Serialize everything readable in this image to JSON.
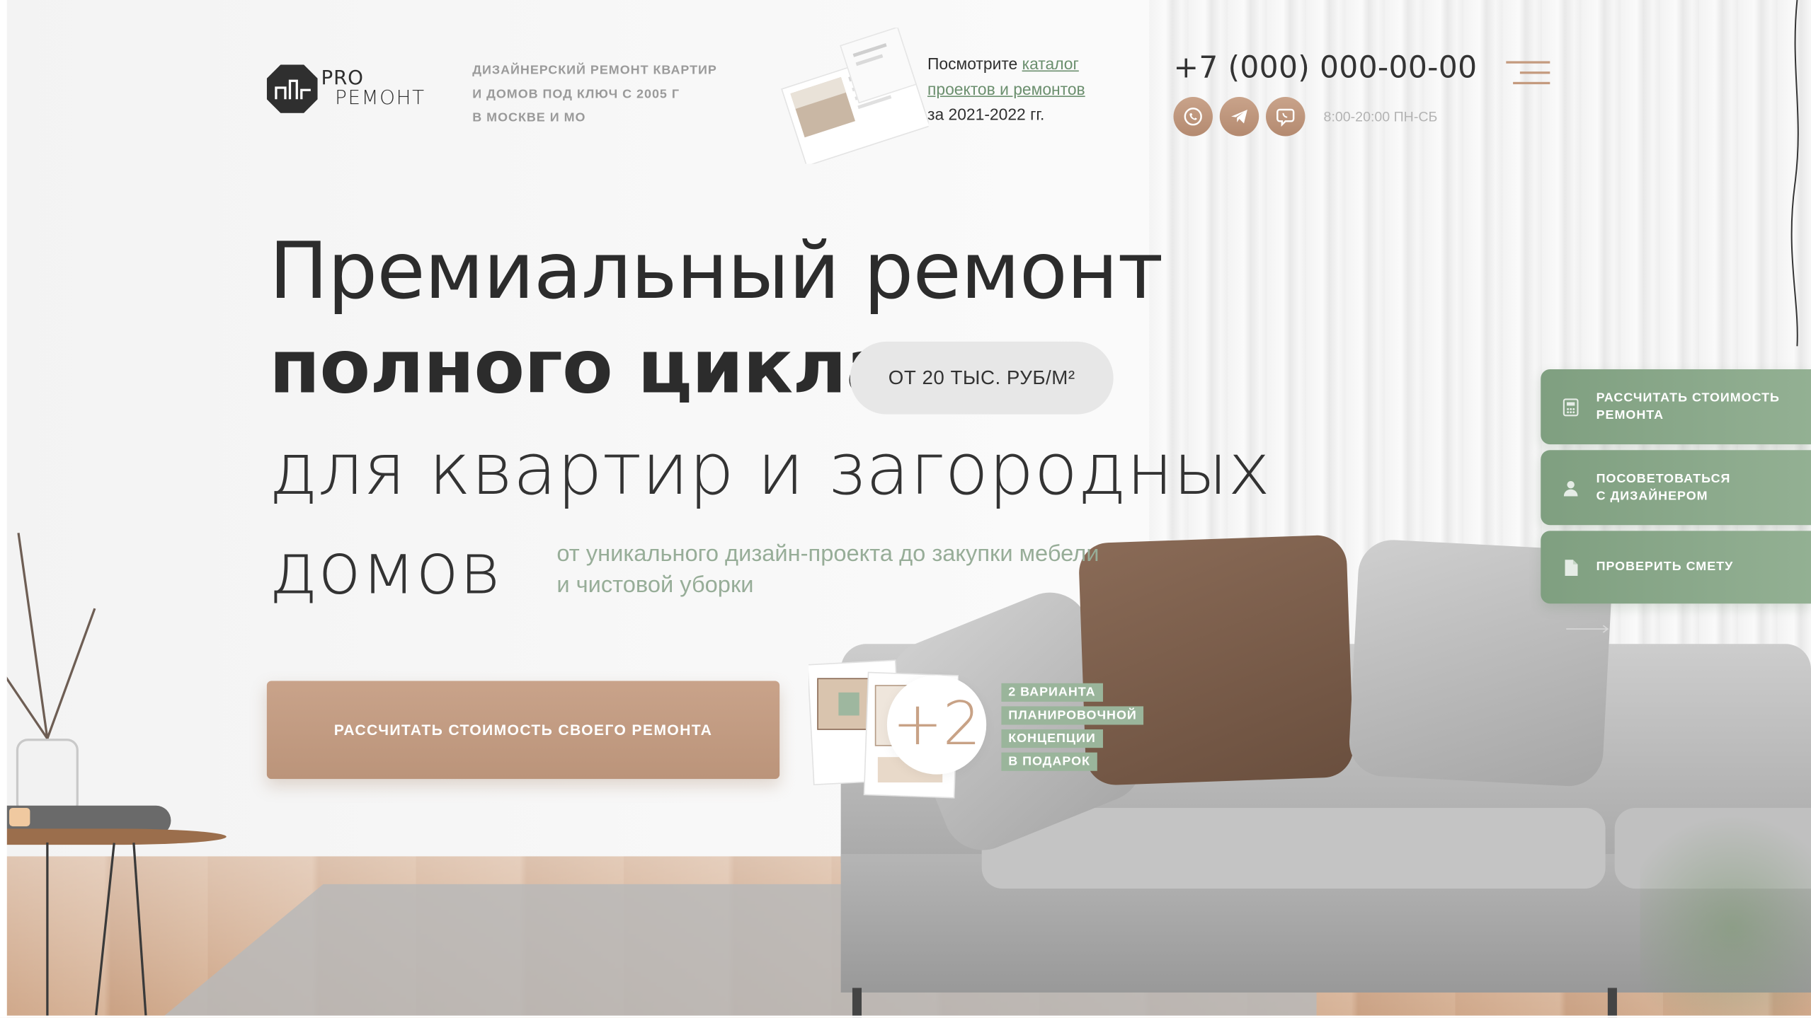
{
  "header": {
    "logo": {
      "word_top": "PRO",
      "word_bottom": "РЕМОНТ"
    },
    "tagline": [
      "ДИЗАЙНЕРСКИЙ РЕМОНТ КВАРТИР",
      "И ДОМОВ ПОД КЛЮЧ С 2005 Г",
      "В МОСКВЕ И МО"
    ],
    "catalog": {
      "prefix": "Посмотрите ",
      "link_line1": "каталог",
      "link_line2": "проектов и ремонтов",
      "suffix": "за 2021-2022 гг."
    },
    "phone": "+7 (000) 000-00-00",
    "socials": [
      {
        "name": "whatsapp-icon"
      },
      {
        "name": "telegram-icon"
      },
      {
        "name": "viber-icon"
      }
    ],
    "hours": "8:00-20:00 ПН-СБ"
  },
  "hero": {
    "line1": "Премиальный ремонт",
    "line2": "полного цикла",
    "price_badge": "ОТ 20 ТЫС. РУБ/М²",
    "line3": "для квартир и загородных",
    "line4": "домов",
    "subtitle": "от уникального дизайн-проекта до закупки мебели и чистовой уборки",
    "cta_label": "РАССЧИТАТЬ СТОИМОСТЬ СВОЕГО РЕМОНТА",
    "bonus_number": "+2",
    "bonus_tags": [
      "2 ВАРИАНТА",
      "ПЛАНИРОВОЧНОЙ",
      "КОНЦЕПЦИИ",
      "В ПОДАРОК"
    ]
  },
  "side_panel": {
    "buttons": [
      {
        "label_line1": "РАССЧИТАТЬ СТОИМОСТЬ",
        "label_line2": "РЕМОНТА",
        "icon": "calculator-icon"
      },
      {
        "label_line1": "ПОСОВЕТОВАТЬСЯ",
        "label_line2": "С ДИЗАЙНЕРОМ",
        "icon": "user-icon"
      },
      {
        "label_line1": "ПРОВЕРИТЬ СМЕТУ",
        "label_line2": "",
        "icon": "document-icon"
      }
    ]
  },
  "colors": {
    "accent_brown": "#c49a7e",
    "accent_green": "#8aa88b",
    "text_dark": "#2c2c2c"
  }
}
